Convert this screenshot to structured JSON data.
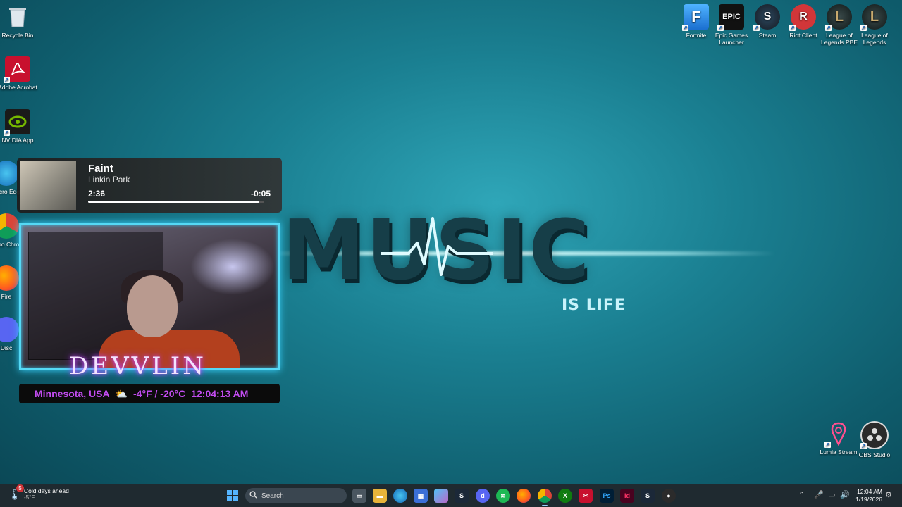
{
  "wallpaper": {
    "headline": "MUSIC",
    "subline": "IS LIFE"
  },
  "desktop_left": [
    {
      "label": "Recycle Bin",
      "icon": "recycle-bin-icon"
    },
    {
      "label": "Adobe Acrobat",
      "icon": "acrobat-icon"
    },
    {
      "label": "NVIDIA App",
      "icon": "nvidia-icon"
    },
    {
      "label": "Micro Edg",
      "icon": "edge-icon"
    },
    {
      "label": "Goo Chro",
      "icon": "chrome-icon"
    },
    {
      "label": "Fire",
      "icon": "firefox-icon"
    },
    {
      "label": "Disc",
      "icon": "discord-icon"
    }
  ],
  "desktop_right": [
    {
      "label": "Fortnite",
      "glyph": "F",
      "color": "#2f8ff0"
    },
    {
      "label": "Epic Games Launcher",
      "glyph": "EPIC",
      "color": "#1a1a1a"
    },
    {
      "label": "Steam",
      "glyph": "S",
      "color": "#1b2838"
    },
    {
      "label": "Riot Client",
      "glyph": "R",
      "color": "#d13639"
    },
    {
      "label": "League of Legends PBE",
      "glyph": "L",
      "color": "#1e2a2e"
    },
    {
      "label": "League of Legends",
      "glyph": "L",
      "color": "#1e2a2e"
    }
  ],
  "desktop_bottom_right": [
    {
      "label": "Lumia Stream",
      "icon": "lumia-icon"
    },
    {
      "label": "OBS Studio",
      "icon": "obs-icon"
    }
  ],
  "media": {
    "title": "Faint",
    "artist": "Linkin Park",
    "elapsed": "2:36",
    "remaining": "-0:05",
    "progress": 0.97
  },
  "overlay": {
    "name": "DEVVLIN",
    "location": "Minnesota, USA",
    "temperature": "-4°F / -20°C",
    "time": "12:04:13 AM"
  },
  "taskbar": {
    "weather_title": "Cold days ahead",
    "weather_temp": "-5°F",
    "weather_badge": "5",
    "search_placeholder": "Search",
    "clock_time": "12:04 AM",
    "clock_date": "1/19/2026"
  }
}
